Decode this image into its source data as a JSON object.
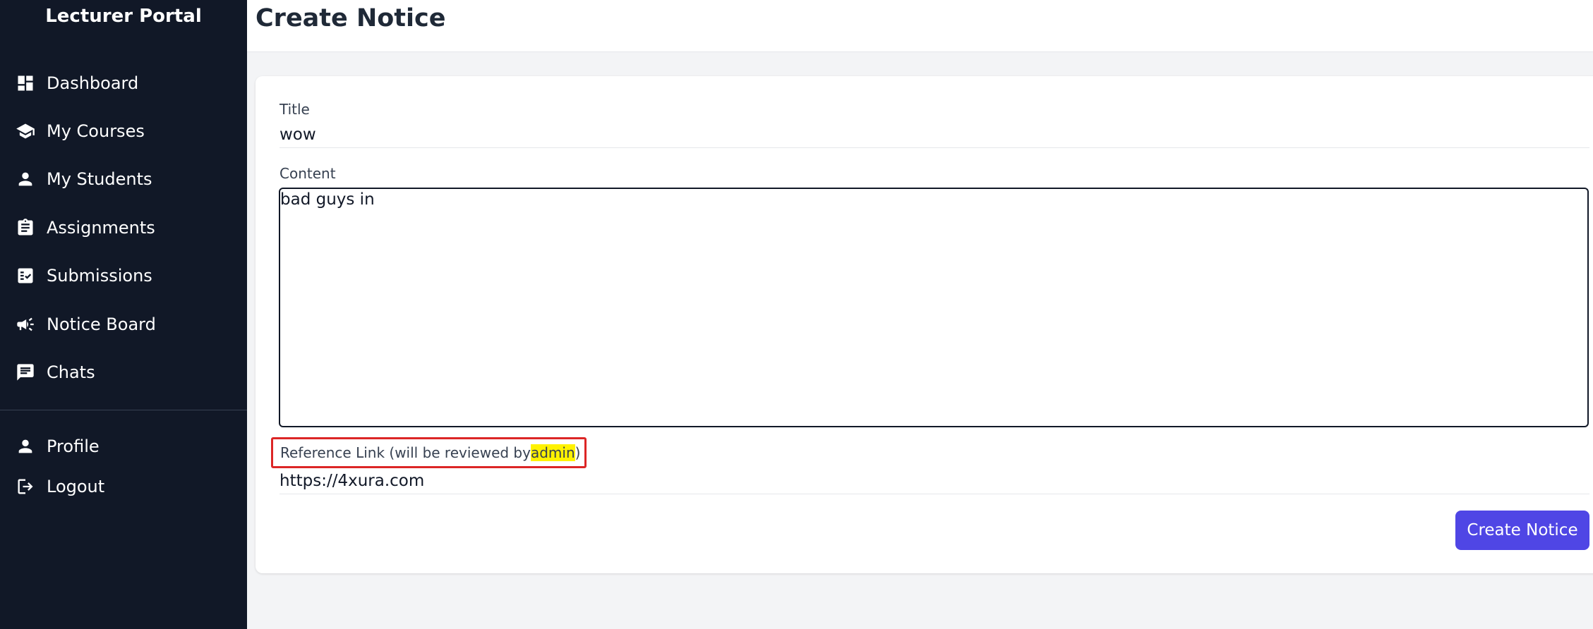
{
  "sidebar": {
    "brand": "Lecturer Portal",
    "items": [
      {
        "label": "Dashboard",
        "icon": "dashboard-icon"
      },
      {
        "label": "My Courses",
        "icon": "graduation-cap-icon"
      },
      {
        "label": "My Students",
        "icon": "person-icon"
      },
      {
        "label": "Assignments",
        "icon": "clipboard-icon"
      },
      {
        "label": "Submissions",
        "icon": "checklist-icon"
      },
      {
        "label": "Notice Board",
        "icon": "megaphone-icon"
      },
      {
        "label": "Chats",
        "icon": "chat-icon"
      }
    ],
    "bottom_items": [
      {
        "label": "Profile",
        "icon": "person-icon"
      },
      {
        "label": "Logout",
        "icon": "logout-icon"
      }
    ]
  },
  "header": {
    "title": "Create Notice"
  },
  "form": {
    "title_label": "Title",
    "title_value": "wow",
    "content_label": "Content",
    "content_value": "bad guys in",
    "reference_label_prefix": "Reference Link (will be reviewed by ",
    "reference_label_highlight": "admin",
    "reference_label_suffix": ")",
    "reference_value": "https://4xura.com",
    "submit_label": "Create Notice"
  },
  "colors": {
    "sidebar_bg": "#111827",
    "accent": "#4f46e5",
    "annotation_border": "#dc2626",
    "highlight": "#fff200"
  }
}
